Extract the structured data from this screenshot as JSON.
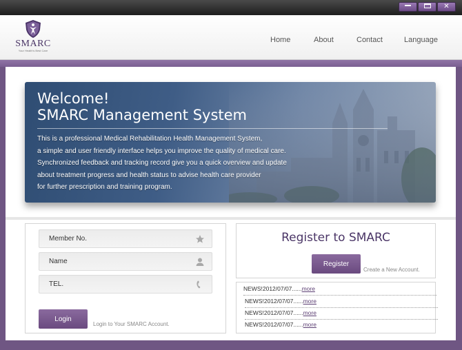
{
  "window": {
    "minimize_label": "",
    "maximize_label": "",
    "close_label": "✕"
  },
  "brand": {
    "name": "SMARC",
    "tagline": "Your Health's Best Care"
  },
  "nav": {
    "items": [
      {
        "label": "Home"
      },
      {
        "label": "About"
      },
      {
        "label": "Contact"
      },
      {
        "label": "Language"
      }
    ]
  },
  "hero": {
    "title_line1": "Welcome!",
    "title_line2": "SMARC Management System",
    "body_lines": [
      "This is a professional Medical Rehabilitation Health Management System,",
      "a simple and user friendly interface helps you improve the quality of medical care.",
      "Synchronized feedback and tracking record give you a quick overview and update",
      "about treatment progress and health status to advise health care provider",
      "for further prescription and training program."
    ]
  },
  "login": {
    "fields": [
      {
        "label": "Member No.",
        "icon": "star-icon"
      },
      {
        "label": "Name",
        "icon": "user-icon"
      },
      {
        "label": "TEL.",
        "icon": "phone-icon"
      }
    ],
    "button_label": "Login",
    "hint": "Login to Your SMARC Account."
  },
  "register": {
    "title": "Register to SMARC",
    "button_label": "Register",
    "hint": "Create a New Account."
  },
  "news": {
    "items": [
      {
        "text": "NEWS!2012/07/07......",
        "more": "more"
      },
      {
        "text": "NEWS!2012/07/07......",
        "more": "more"
      },
      {
        "text": "NEWS!2012/07/07......",
        "more": "more"
      },
      {
        "text": "NEWS!2012/07/07......",
        "more": "more"
      }
    ]
  },
  "colors": {
    "accent": "#6f5683",
    "brand_text": "#4a3566",
    "button": "#7a5a8f",
    "link": "#5c3f73"
  }
}
